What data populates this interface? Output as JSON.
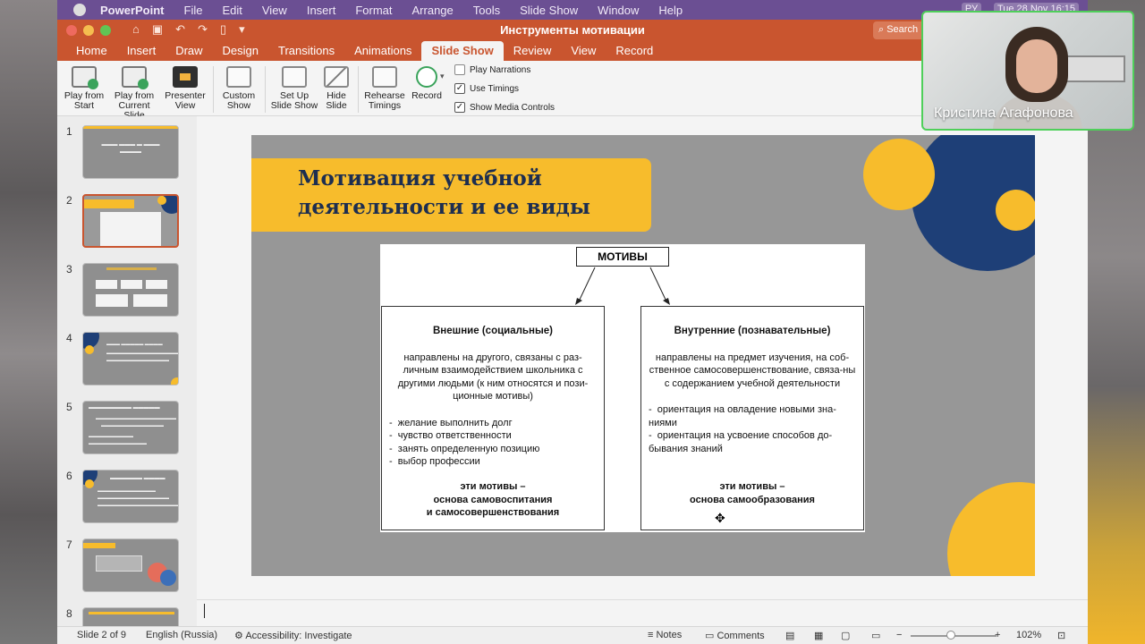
{
  "menubar": {
    "app": "PowerPoint",
    "items": [
      "File",
      "Edit",
      "View",
      "Insert",
      "Format",
      "Arrange",
      "Tools",
      "Slide Show",
      "Window",
      "Help"
    ],
    "status_lang": "РУ",
    "status_time": "Tue 28 Nov 16:15"
  },
  "titlebar": {
    "doc_title": "Инструменты мотивации",
    "search_placeholder": "Search"
  },
  "tabs": [
    "Home",
    "Insert",
    "Draw",
    "Design",
    "Transitions",
    "Animations",
    "Slide Show",
    "Review",
    "View",
    "Record"
  ],
  "active_tab": "Slide Show",
  "ribbon": {
    "play_from_start": "Play from Start",
    "play_from_current": "Play from Current Slide",
    "presenter_view": "Presenter View",
    "custom_show": "Custom Show",
    "set_up": "Set Up Slide Show",
    "hide_slide": "Hide Slide",
    "rehearse": "Rehearse Timings",
    "record": "Record",
    "play_narrations": "Play Narrations",
    "use_timings": "Use Timings",
    "show_media_controls": "Show Media Controls",
    "play_narrations_checked": false,
    "use_timings_checked": true,
    "show_media_checked": true
  },
  "thumbnails": [
    "1",
    "2",
    "3",
    "4",
    "5",
    "6",
    "7",
    "8"
  ],
  "selected_slide": 2,
  "slide": {
    "title_line1": "Мотивация учебной",
    "title_line2": "деятельности и ее виды",
    "root": "МОТИВЫ",
    "left": {
      "heading": "Внешние (социальные)",
      "desc": "направлены на другого, связаны с раз-личным взаимодействием школьника с другими людьми (к ним относятся и пози-ционные  мотивы)",
      "items": [
        "желание выполнить долг",
        "чувство ответственности",
        "занять определенную позицию",
        "выбор профессии"
      ],
      "foot1": "эти мотивы –",
      "foot2": "основа самовоспитания",
      "foot3": "и самосовершенствования"
    },
    "right": {
      "heading": "Внутренние (познавательные)",
      "desc": "направлены на предмет изучения, на соб-ственное самосовершенствование, связа-ны с содержанием учебной деятельности",
      "items": [
        "ориентация на овладение новыми зна-ниями",
        "ориентация на усвоение способов до-бывания знаний"
      ],
      "foot1": "эти мотивы –",
      "foot2": "основа самообразования"
    }
  },
  "statusbar": {
    "slide_pos": "Slide 2 of 9",
    "language": "English (Russia)",
    "accessibility": "Accessibility: Investigate",
    "notes": "Notes",
    "comments": "Comments",
    "zoom": "102%"
  },
  "webcam": {
    "name": "Кристина Агафонова"
  },
  "colors": {
    "accent": "#c9552f",
    "slide_yellow": "#f7bc2c",
    "slide_navy": "#1e3f77",
    "menubar": "#6b4f93"
  }
}
